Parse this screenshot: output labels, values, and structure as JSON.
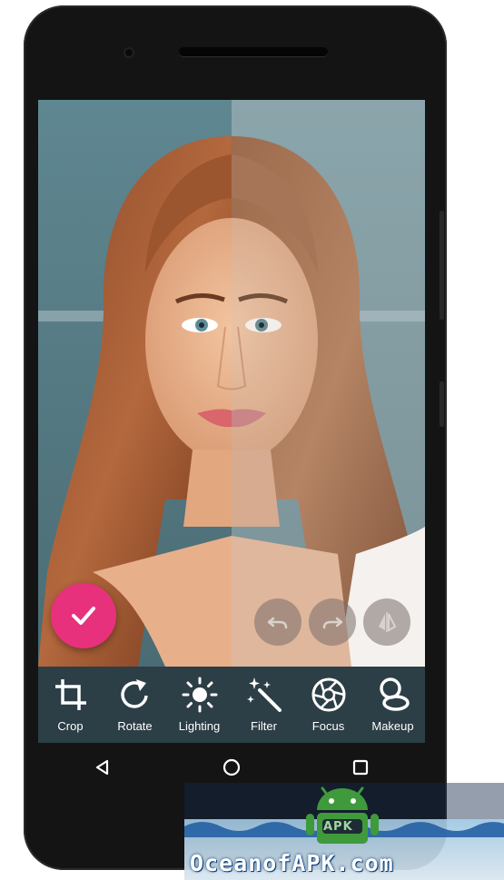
{
  "toolbar": {
    "tools": [
      {
        "label": "Crop",
        "icon": "crop-icon"
      },
      {
        "label": "Rotate",
        "icon": "rotate-icon"
      },
      {
        "label": "Lighting",
        "icon": "lighting-icon"
      },
      {
        "label": "Filter",
        "icon": "magic-wand-icon"
      },
      {
        "label": "Focus",
        "icon": "aperture-icon"
      },
      {
        "label": "Makeup",
        "icon": "makeup-icon"
      }
    ]
  },
  "actions": {
    "confirm_icon": "checkmark-icon",
    "undo_icon": "undo-icon",
    "redo_icon": "redo-icon",
    "compare_icon": "compare-icon"
  },
  "navbar": {
    "back_icon": "back-triangle-icon",
    "home_icon": "home-circle-icon",
    "recents_icon": "recents-square-icon"
  },
  "watermark": {
    "text": "OceanofAPK.com",
    "logo_text": "APK"
  },
  "colors": {
    "accent": "#e8317d",
    "toolbar_bg": "#2c3e46",
    "phone_body": "#141414",
    "watermark_android": "#3f9a3b"
  }
}
